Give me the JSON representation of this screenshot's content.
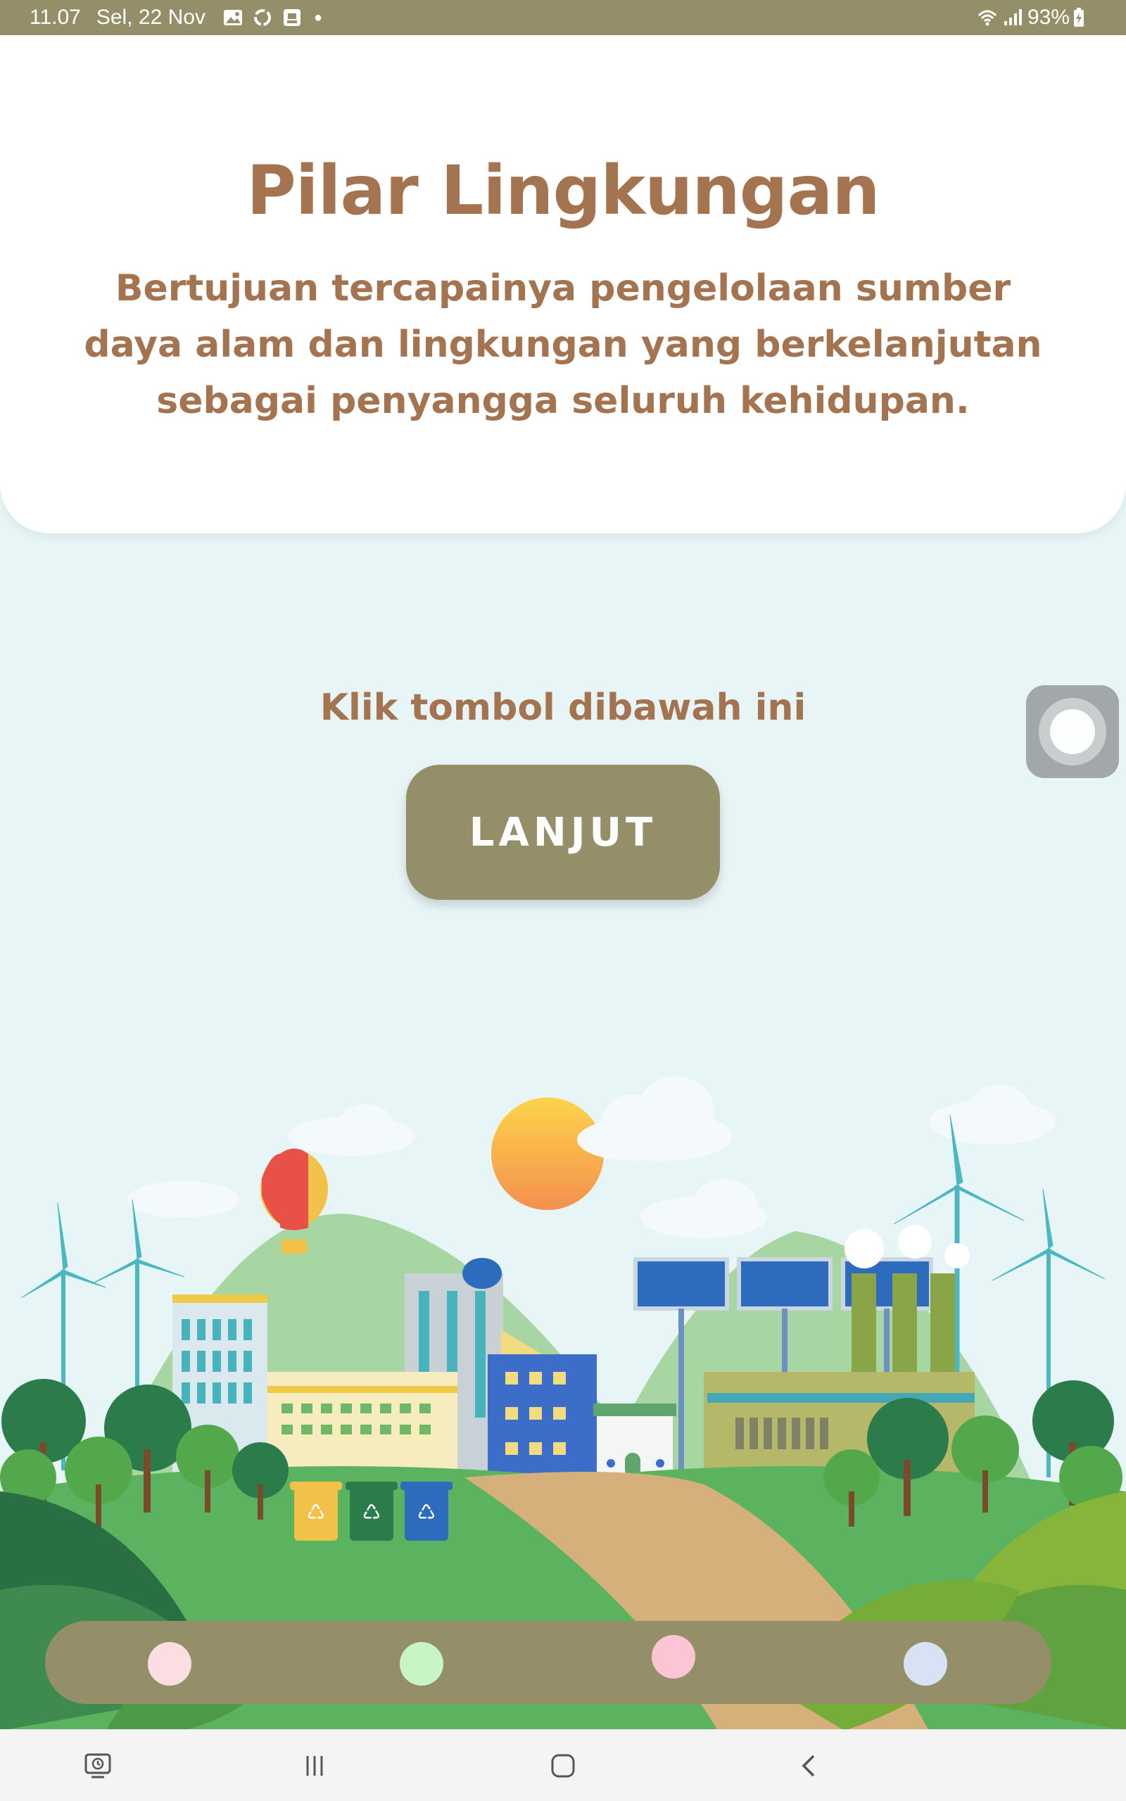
{
  "status_bar": {
    "time": "11.07",
    "date": "Sel, 22 Nov",
    "battery": "93%",
    "icons": [
      "gallery-icon",
      "sync-icon",
      "screenshot-icon",
      "notification-dot-icon",
      "wifi-icon",
      "signal-icon",
      "battery-charging-icon"
    ]
  },
  "header": {
    "title": "Pilar Lingkungan",
    "description": "Bertujuan tercapainya pengelolaan sumber daya alam dan lingkungan yang berkelanjutan sebagai penyangga seluruh kehidupan."
  },
  "main": {
    "prompt": "Klik tombol dibawah ini",
    "button_label": "LANJUT"
  },
  "pill_nav": {
    "dots": [
      {
        "name": "nav-dot-1",
        "color": "#fcdde1"
      },
      {
        "name": "nav-dot-2",
        "color": "#c8f5c6"
      },
      {
        "name": "nav-dot-3",
        "color": "#fbc5d4"
      },
      {
        "name": "nav-dot-4",
        "color": "#d7e2f5"
      }
    ]
  },
  "system_nav": {
    "buttons": [
      "recent-apps-icon",
      "recents-icon",
      "home-icon",
      "back-icon"
    ]
  },
  "colors": {
    "accent": "#958f69",
    "title_brown": "#a47350",
    "background": "#e8f5f6"
  }
}
